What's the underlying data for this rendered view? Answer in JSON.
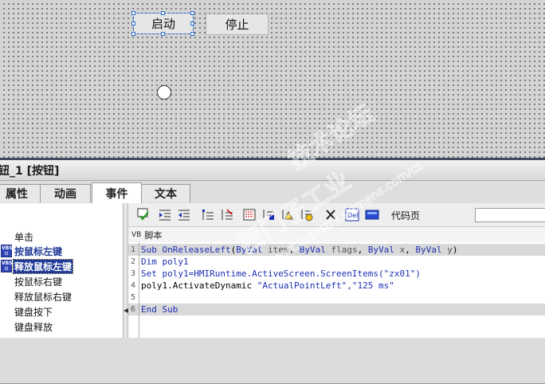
{
  "canvas": {
    "buttons": {
      "start_label": "启动",
      "stop_label": "停止"
    }
  },
  "properties": {
    "title": "钮_1 [按钮]",
    "tabs": [
      {
        "label": "属性"
      },
      {
        "label": "动画"
      },
      {
        "label": "事件"
      },
      {
        "label": "文本"
      }
    ],
    "active_tab": "事件"
  },
  "events": {
    "items": [
      {
        "label": "单击"
      },
      {
        "label": "按鼠标左键"
      },
      {
        "label": "释放鼠标左键"
      },
      {
        "label": "按鼠标右键"
      },
      {
        "label": "释放鼠标右键"
      },
      {
        "label": "键盘按下"
      },
      {
        "label": "键盘释放"
      }
    ],
    "selected": "释放鼠标左键"
  },
  "toolbar": {
    "codepage_label": "代码页",
    "codepage_value": ""
  },
  "script": {
    "header_prefix": "VB",
    "header_label": "脚本",
    "lines": [
      {
        "n": "1"
      },
      {
        "n": "2"
      },
      {
        "n": "3"
      },
      {
        "n": "4"
      },
      {
        "n": "5"
      },
      {
        "n": "6"
      }
    ],
    "code_line2": "Dim poly1",
    "code_line3": "Set poly1=HMIRuntime.ActiveScreen.ScreenItems(\"zx01\")",
    "code_line4_obj": "poly1.ActivateDynamic ",
    "code_line4_args": "\"ActualPointLeft\",\"125 ms\"",
    "sub_kw": "Sub",
    "sub_name": "OnReleaseLeft",
    "byval": "ByVal",
    "params": [
      "item",
      "flags",
      "x",
      "y"
    ],
    "end_sub": "End Sub"
  },
  "watermark": {
    "line1": "技术论坛",
    "line2": "西门子工业",
    "line3": "support.industry.siemens.com/cs"
  }
}
